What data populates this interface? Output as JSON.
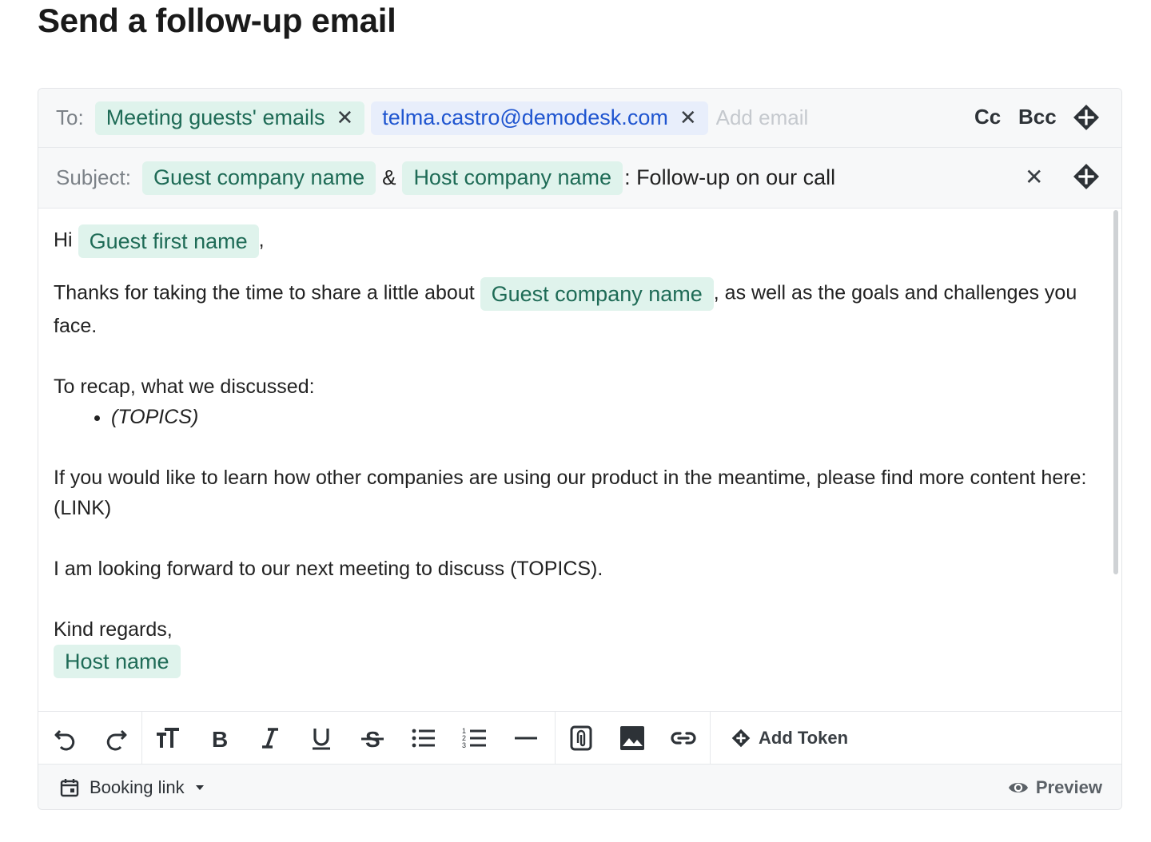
{
  "page": {
    "title": "Send a follow-up email"
  },
  "to": {
    "label": "To:",
    "chips": [
      {
        "label": "Meeting guests' emails",
        "kind": "token"
      },
      {
        "label": "telma.castro@demodesk.com",
        "kind": "email"
      }
    ],
    "add_placeholder": "Add email",
    "cc_label": "Cc",
    "bcc_label": "Bcc",
    "remove_glyph": "✕"
  },
  "subject": {
    "label": "Subject:",
    "token1": "Guest company name",
    "separator": "&",
    "token2": "Host company name",
    "text": ": Follow-up on our call",
    "clear_glyph": "✕"
  },
  "body": {
    "greeting_prefix": "Hi",
    "greeting_token": "Guest first name",
    "greeting_suffix": ",",
    "thanks_prefix": "Thanks for taking the time to share a little about",
    "thanks_token": "Guest company name",
    "thanks_suffix": ", as well as the goals and challenges you face.",
    "recap_intro": "To recap, what we discussed:",
    "recap_items": [
      "(TOPICS)"
    ],
    "learn_more": "If you would like to learn how other companies are using our product in the meantime, please find more content here: (LINK)",
    "next_meeting": "I am looking forward to our next meeting to discuss (TOPICS).",
    "closing": "Kind regards,",
    "signature_token": "Host name"
  },
  "toolbar": {
    "buttons": [
      "undo-icon",
      "redo-icon",
      "text-size-icon",
      "bold-icon",
      "italic-icon",
      "underline-icon",
      "strikethrough-icon",
      "bulleted-list-icon",
      "numbered-list-icon",
      "horizontal-rule-icon",
      "attachment-icon",
      "image-icon",
      "link-icon"
    ],
    "add_token_label": "Add Token"
  },
  "footer": {
    "booking_label": "Booking link",
    "preview_label": "Preview"
  },
  "colors": {
    "token_bg": "#dff3ec",
    "token_text": "#1e6b56",
    "email_bg": "#e8eefb",
    "email_text": "#1f55d0"
  }
}
